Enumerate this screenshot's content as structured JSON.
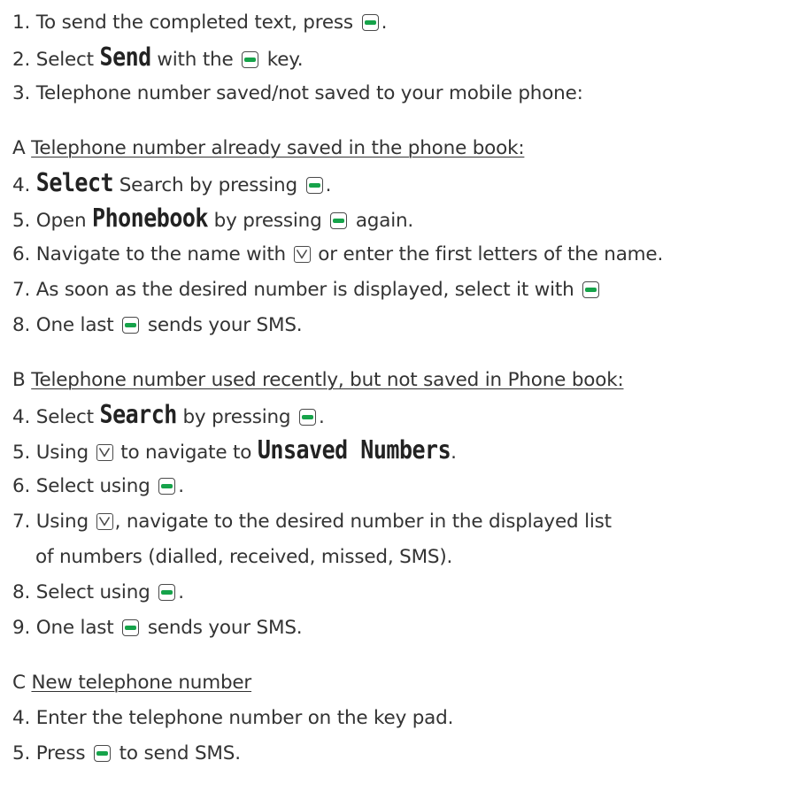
{
  "steps": {
    "s1": [
      "1. To send the completed text, press",
      "."
    ],
    "s2": [
      "2. Select",
      "Send",
      "with the",
      "key."
    ],
    "s3": "3. Telephone number saved/not saved to your mobile phone:"
  },
  "section_a": {
    "letter": "A",
    "heading": "Telephone number already saved in the phone book:",
    "s4": [
      "4.",
      "Select",
      "Search by pressing",
      "."
    ],
    "s5": [
      "5. Open",
      "Phonebook",
      "by pressing",
      "again."
    ],
    "s6": [
      "6. Navigate to the name with",
      "or enter the first letters of the name."
    ],
    "s7": "7. As soon as the desired number is displayed, select it with",
    "s8": [
      "8. One last",
      "sends your SMS."
    ]
  },
  "section_b": {
    "letter": "B",
    "heading": "Telephone number used recently, but not saved in Phone book:",
    "s4": [
      "4. Select",
      "Search",
      "by pressing",
      "."
    ],
    "s5": [
      "5. Using",
      "to navigate to",
      "Unsaved Numbers",
      "."
    ],
    "s6": [
      "6. Select using",
      "."
    ],
    "s7": [
      "7. Using",
      ", navigate to the desired number in the displayed list",
      "of numbers (dialled, received, missed, SMS)."
    ],
    "s8": [
      "8. Select using",
      "."
    ],
    "s9": [
      "9. One last",
      "sends your SMS."
    ]
  },
  "section_c": {
    "letter": "C",
    "heading": "New telephone number",
    "s4": "4. Enter the telephone number on the key pad.",
    "s5": [
      "5. Press",
      "to send SMS."
    ]
  },
  "icons": {
    "action_key": "green-action-key-icon",
    "nav_down": "navigation-down-key-icon"
  },
  "colors": {
    "key_green": "#16a34a",
    "text": "#333333"
  }
}
